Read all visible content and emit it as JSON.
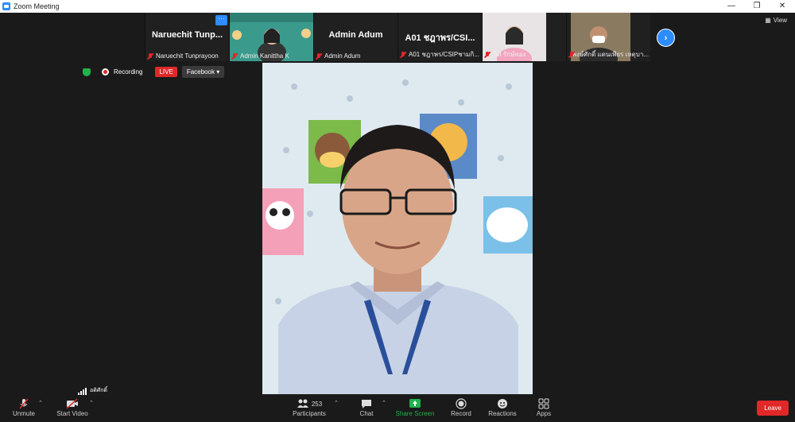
{
  "window": {
    "title": "Zoom Meeting"
  },
  "participants_strip": {
    "tiles": [
      {
        "big_name": "Naruechit  Tunp...",
        "caption": "Naruechit Tunprayoon"
      },
      {
        "big_name": "",
        "caption": "Admin Kanittha K"
      },
      {
        "big_name": "Admin Adum",
        "caption": "Admin Adum"
      },
      {
        "big_name": "A01 ชฎาพร/CSI...",
        "caption": "A01 ชฎาพร/CSIPชามกิ..."
      },
      {
        "big_name": "",
        "caption": "นิติ รักษ์ทอง"
      },
      {
        "big_name": "",
        "caption": "พงษ์ศักดิ์ แดนเพียร เหตุบา..."
      }
    ],
    "view_label": "View"
  },
  "recording": {
    "label": "Recording",
    "live_label": "LIVE",
    "stream_target": "Facebook"
  },
  "signal_label": "อดิศักดิ์",
  "toolbar": {
    "unmute_label": "Unmute",
    "start_video_label": "Start Video",
    "participants_label": "Participants",
    "participants_count": "253",
    "chat_label": "Chat",
    "share_screen_label": "Share Screen",
    "record_label": "Record",
    "reactions_label": "Reactions",
    "apps_label": "Apps",
    "leave_label": "Leave"
  },
  "colors": {
    "accent": "#2d8cff",
    "live": "#e02828",
    "share": "#22b14c"
  }
}
